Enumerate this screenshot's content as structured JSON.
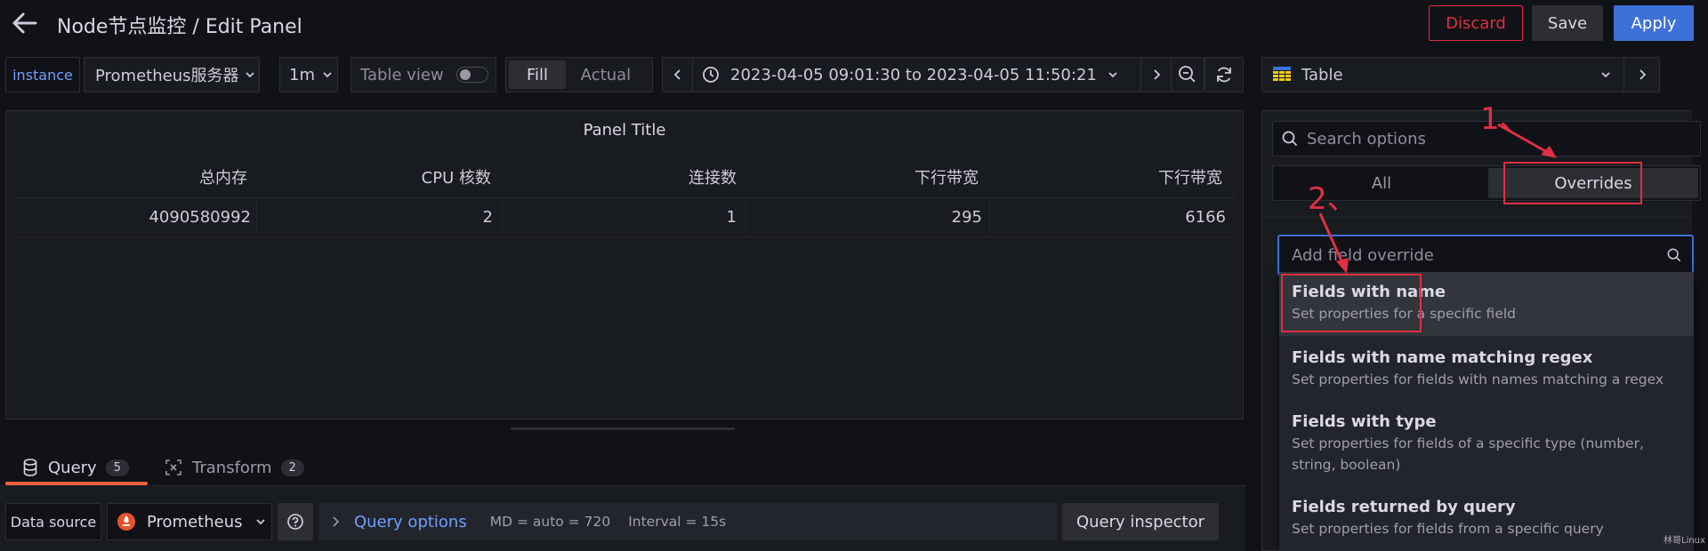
{
  "header": {
    "title": "Node节点监控 / Edit Panel",
    "discard_label": "Discard",
    "save_label": "Save",
    "apply_label": "Apply"
  },
  "toolbar": {
    "variable_label": "instance",
    "variable_value": "Prometheus服务器",
    "interval_value": "1m",
    "table_view_label": "Table view",
    "table_view_on": false,
    "fill_label": "Fill",
    "actual_label": "Actual",
    "time_range": "2023-04-05 09:01:30 to 2023-04-05 11:50:21"
  },
  "panel": {
    "title": "Panel Title",
    "columns": [
      "总内存",
      "CPU 核数",
      "连接数",
      "下行带宽",
      "下行带宽"
    ],
    "rows": [
      [
        "4090580992",
        "2",
        "1",
        "295",
        "6166"
      ]
    ]
  },
  "query_tabs": {
    "query_label": "Query",
    "query_count": "5",
    "transform_label": "Transform",
    "transform_count": "2"
  },
  "query_bar": {
    "data_source_label": "Data source",
    "data_source_value": "Prometheus",
    "query_options_label": "Query options",
    "md_text": "MD = auto = 720",
    "interval_text": "Interval = 15s",
    "inspector_label": "Query inspector"
  },
  "options_pane": {
    "visualization": "Table",
    "search_placeholder": "Search options",
    "tab_all": "All",
    "tab_overrides": "Overrides",
    "override_placeholder": "Add field override",
    "override_options": [
      {
        "title": "Fields with name",
        "desc": "Set properties for a specific field"
      },
      {
        "title": "Fields with name matching regex",
        "desc": "Set properties for fields with names matching a regex"
      },
      {
        "title": "Fields with type",
        "desc": "Set properties for fields of a specific type (number, string, boolean)"
      },
      {
        "title": "Fields returned by query",
        "desc": "Set properties for fields from a specific query"
      }
    ]
  },
  "annotations": {
    "step1": "1、",
    "step2": "2、"
  },
  "watermark": "林哥Linux",
  "colors": {
    "primary": "#3d71d9",
    "discard": "#e02f44",
    "query_tab_underline": "#f55f3e",
    "annotation": "#e02f44"
  }
}
